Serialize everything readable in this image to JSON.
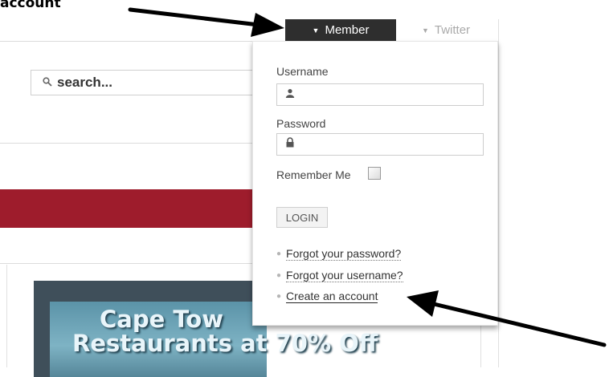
{
  "annotation": {
    "text": "account"
  },
  "search": {
    "placeholder": "search..."
  },
  "banner": {
    "line1": "Cape Tow",
    "line2": "Restaurants at 70% Off"
  },
  "tabs": [
    {
      "label": "Member",
      "active": true
    },
    {
      "label": "Twitter",
      "active": false
    }
  ],
  "login": {
    "username_label": "Username",
    "password_label": "Password",
    "remember_label": "Remember Me",
    "remember_checked": false,
    "button_label": "LOGIN",
    "links": [
      "Forgot your password?",
      "Forgot your username?",
      "Create an account"
    ]
  },
  "colors": {
    "active_tab": "#2e2e2e",
    "red_band": "#9e1c2c",
    "panel_border": "#e6e6e6"
  },
  "icons": {
    "search": "magnifier-icon",
    "user": "user-icon",
    "lock": "lock-icon",
    "dropdown": "triangle-down-icon"
  }
}
